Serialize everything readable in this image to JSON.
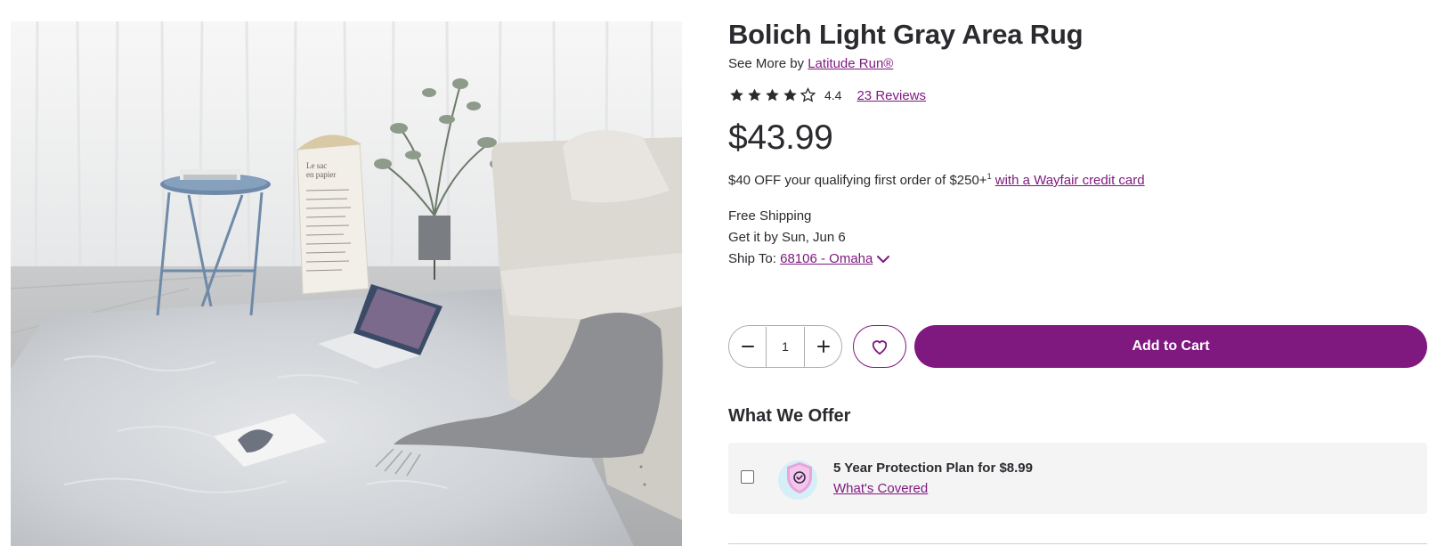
{
  "product": {
    "title": "Bolich Light Gray Area Rug",
    "see_more_prefix": "See More by ",
    "brand": "Latitude Run®",
    "rating": "4.4",
    "rating_stars": 4.4,
    "reviews_label": "23 Reviews",
    "price": "$43.99",
    "photo_alt": "Light gray shag rug in living room"
  },
  "promo": {
    "text": "$40 OFF your qualifying first order of $250+",
    "footnote": "1",
    "link": "with a Wayfair credit card"
  },
  "shipping": {
    "free": "Free Shipping",
    "delivery": "Get it by Sun, Jun 6",
    "ship_to_label": "Ship To: ",
    "location": "68106 - Omaha"
  },
  "cart": {
    "quantity": "1",
    "add_to_cart": "Add to Cart"
  },
  "offer": {
    "section_title": "What We Offer",
    "plan_title": "5 Year Protection Plan for $8.99",
    "plan_link": "What's Covered"
  },
  "colors": {
    "brand_purple": "#7f187f",
    "text": "#2b2a2f",
    "card_bg": "#f4f4f5"
  },
  "icons": {
    "rating": "star-icon",
    "decrement": "minus-icon",
    "increment": "plus-icon",
    "favorite": "heart-icon",
    "location_toggle": "chevron-down-icon",
    "protection": "shield-check-icon"
  }
}
